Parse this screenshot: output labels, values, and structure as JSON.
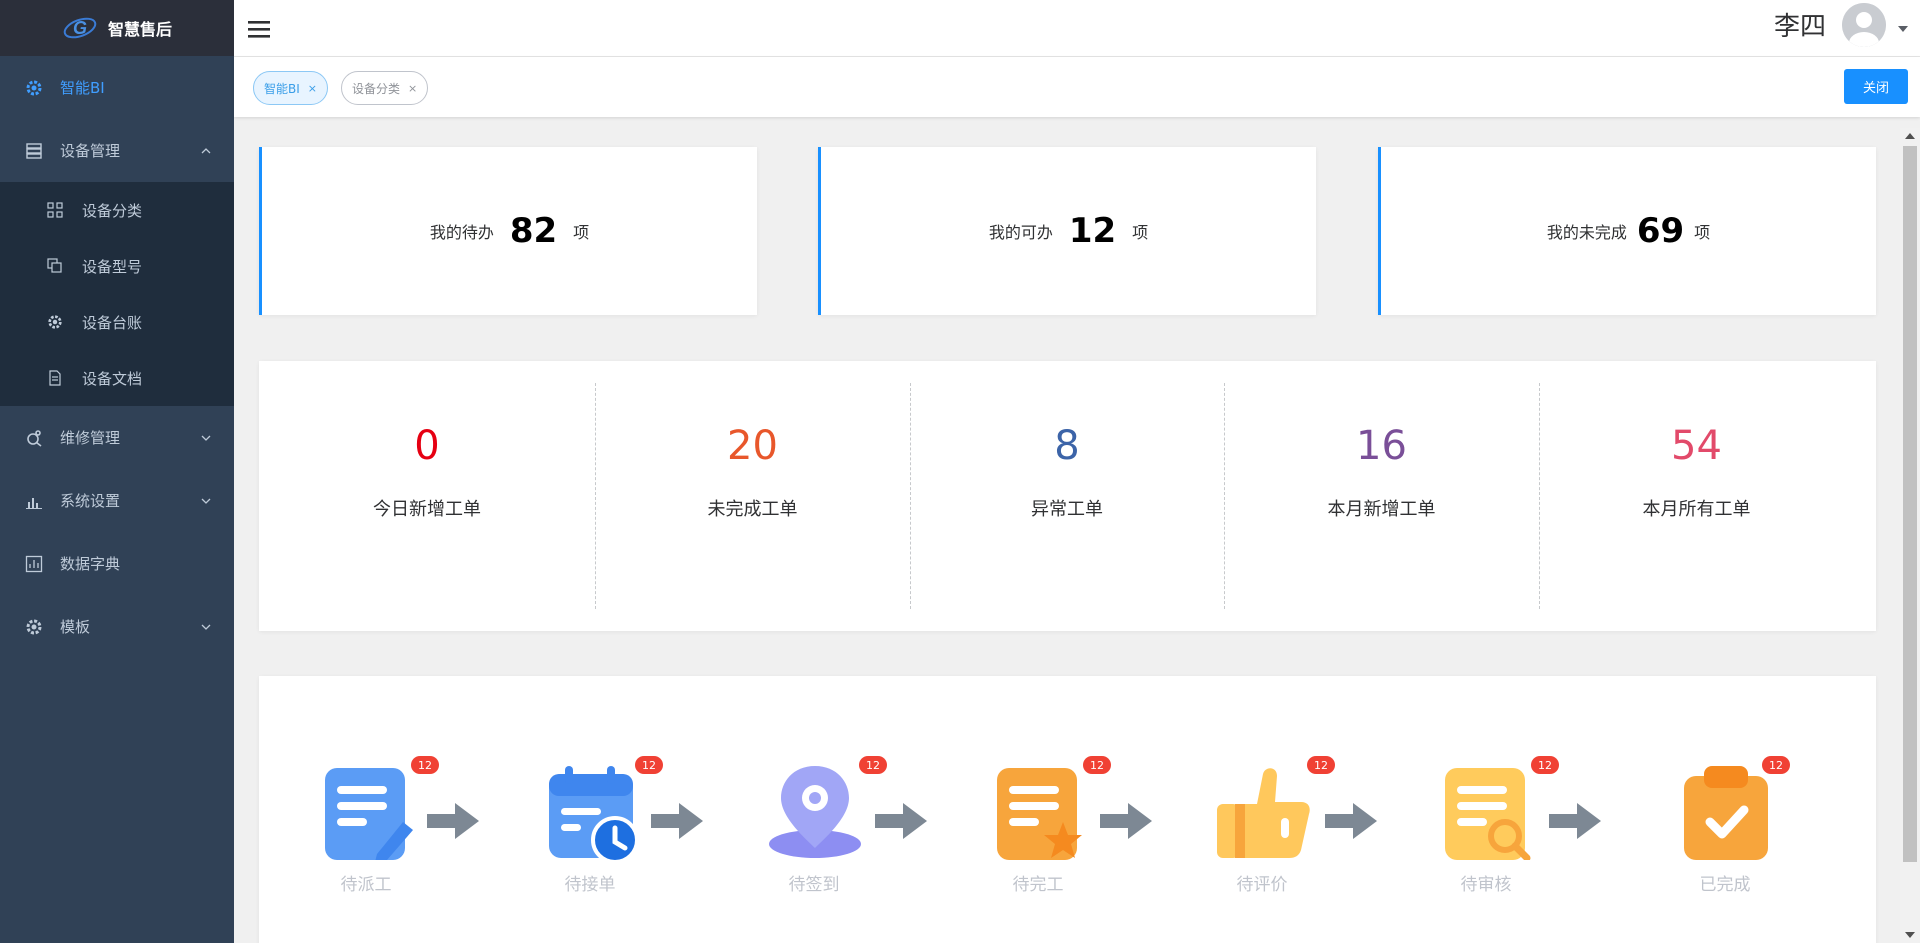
{
  "app": {
    "title": "智慧售后"
  },
  "header": {
    "user_name": "李四"
  },
  "sidebar": {
    "items": [
      {
        "label": "智能BI"
      },
      {
        "label": "设备管理"
      },
      {
        "label": "维修管理"
      },
      {
        "label": "系统设置"
      },
      {
        "label": "数据字典"
      },
      {
        "label": "模板"
      }
    ],
    "subitems": [
      {
        "label": "设备分类"
      },
      {
        "label": "设备型号"
      },
      {
        "label": "设备台账"
      },
      {
        "label": "设备文档"
      }
    ]
  },
  "tags": [
    {
      "label": "智能BI",
      "close": "×"
    },
    {
      "label": "设备分类",
      "close": "×"
    }
  ],
  "close_button": "关闭",
  "stat_cards": [
    {
      "label": "我的待办",
      "value": "82",
      "unit": "项"
    },
    {
      "label": "我的可办",
      "value": "12",
      "unit": "项"
    },
    {
      "label": "我的未完成",
      "value": "69",
      "unit": "项"
    }
  ],
  "order_stats": [
    {
      "value": "0",
      "label": "今日新增工单",
      "color": "#e60012"
    },
    {
      "value": "20",
      "label": "未完成工单",
      "color": "#e8572b"
    },
    {
      "value": "8",
      "label": "异常工单",
      "color": "#3c64a8"
    },
    {
      "value": "16",
      "label": "本月新增工单",
      "color": "#7a4f98"
    },
    {
      "value": "54",
      "label": "本月所有工单",
      "color": "#e24a6a"
    }
  ],
  "flow_steps": [
    {
      "label": "待派工",
      "badge": "12",
      "icon": "document-pen-icon"
    },
    {
      "label": "待接单",
      "badge": "12",
      "icon": "calendar-clock-icon"
    },
    {
      "label": "待签到",
      "badge": "12",
      "icon": "location-pin-icon"
    },
    {
      "label": "待完工",
      "badge": "12",
      "icon": "document-star-icon"
    },
    {
      "label": "待评价",
      "badge": "12",
      "icon": "thumbs-up-icon"
    },
    {
      "label": "待审核",
      "badge": "12",
      "icon": "document-search-icon"
    },
    {
      "label": "已完成",
      "badge": "12",
      "icon": "clipboard-check-icon"
    }
  ]
}
